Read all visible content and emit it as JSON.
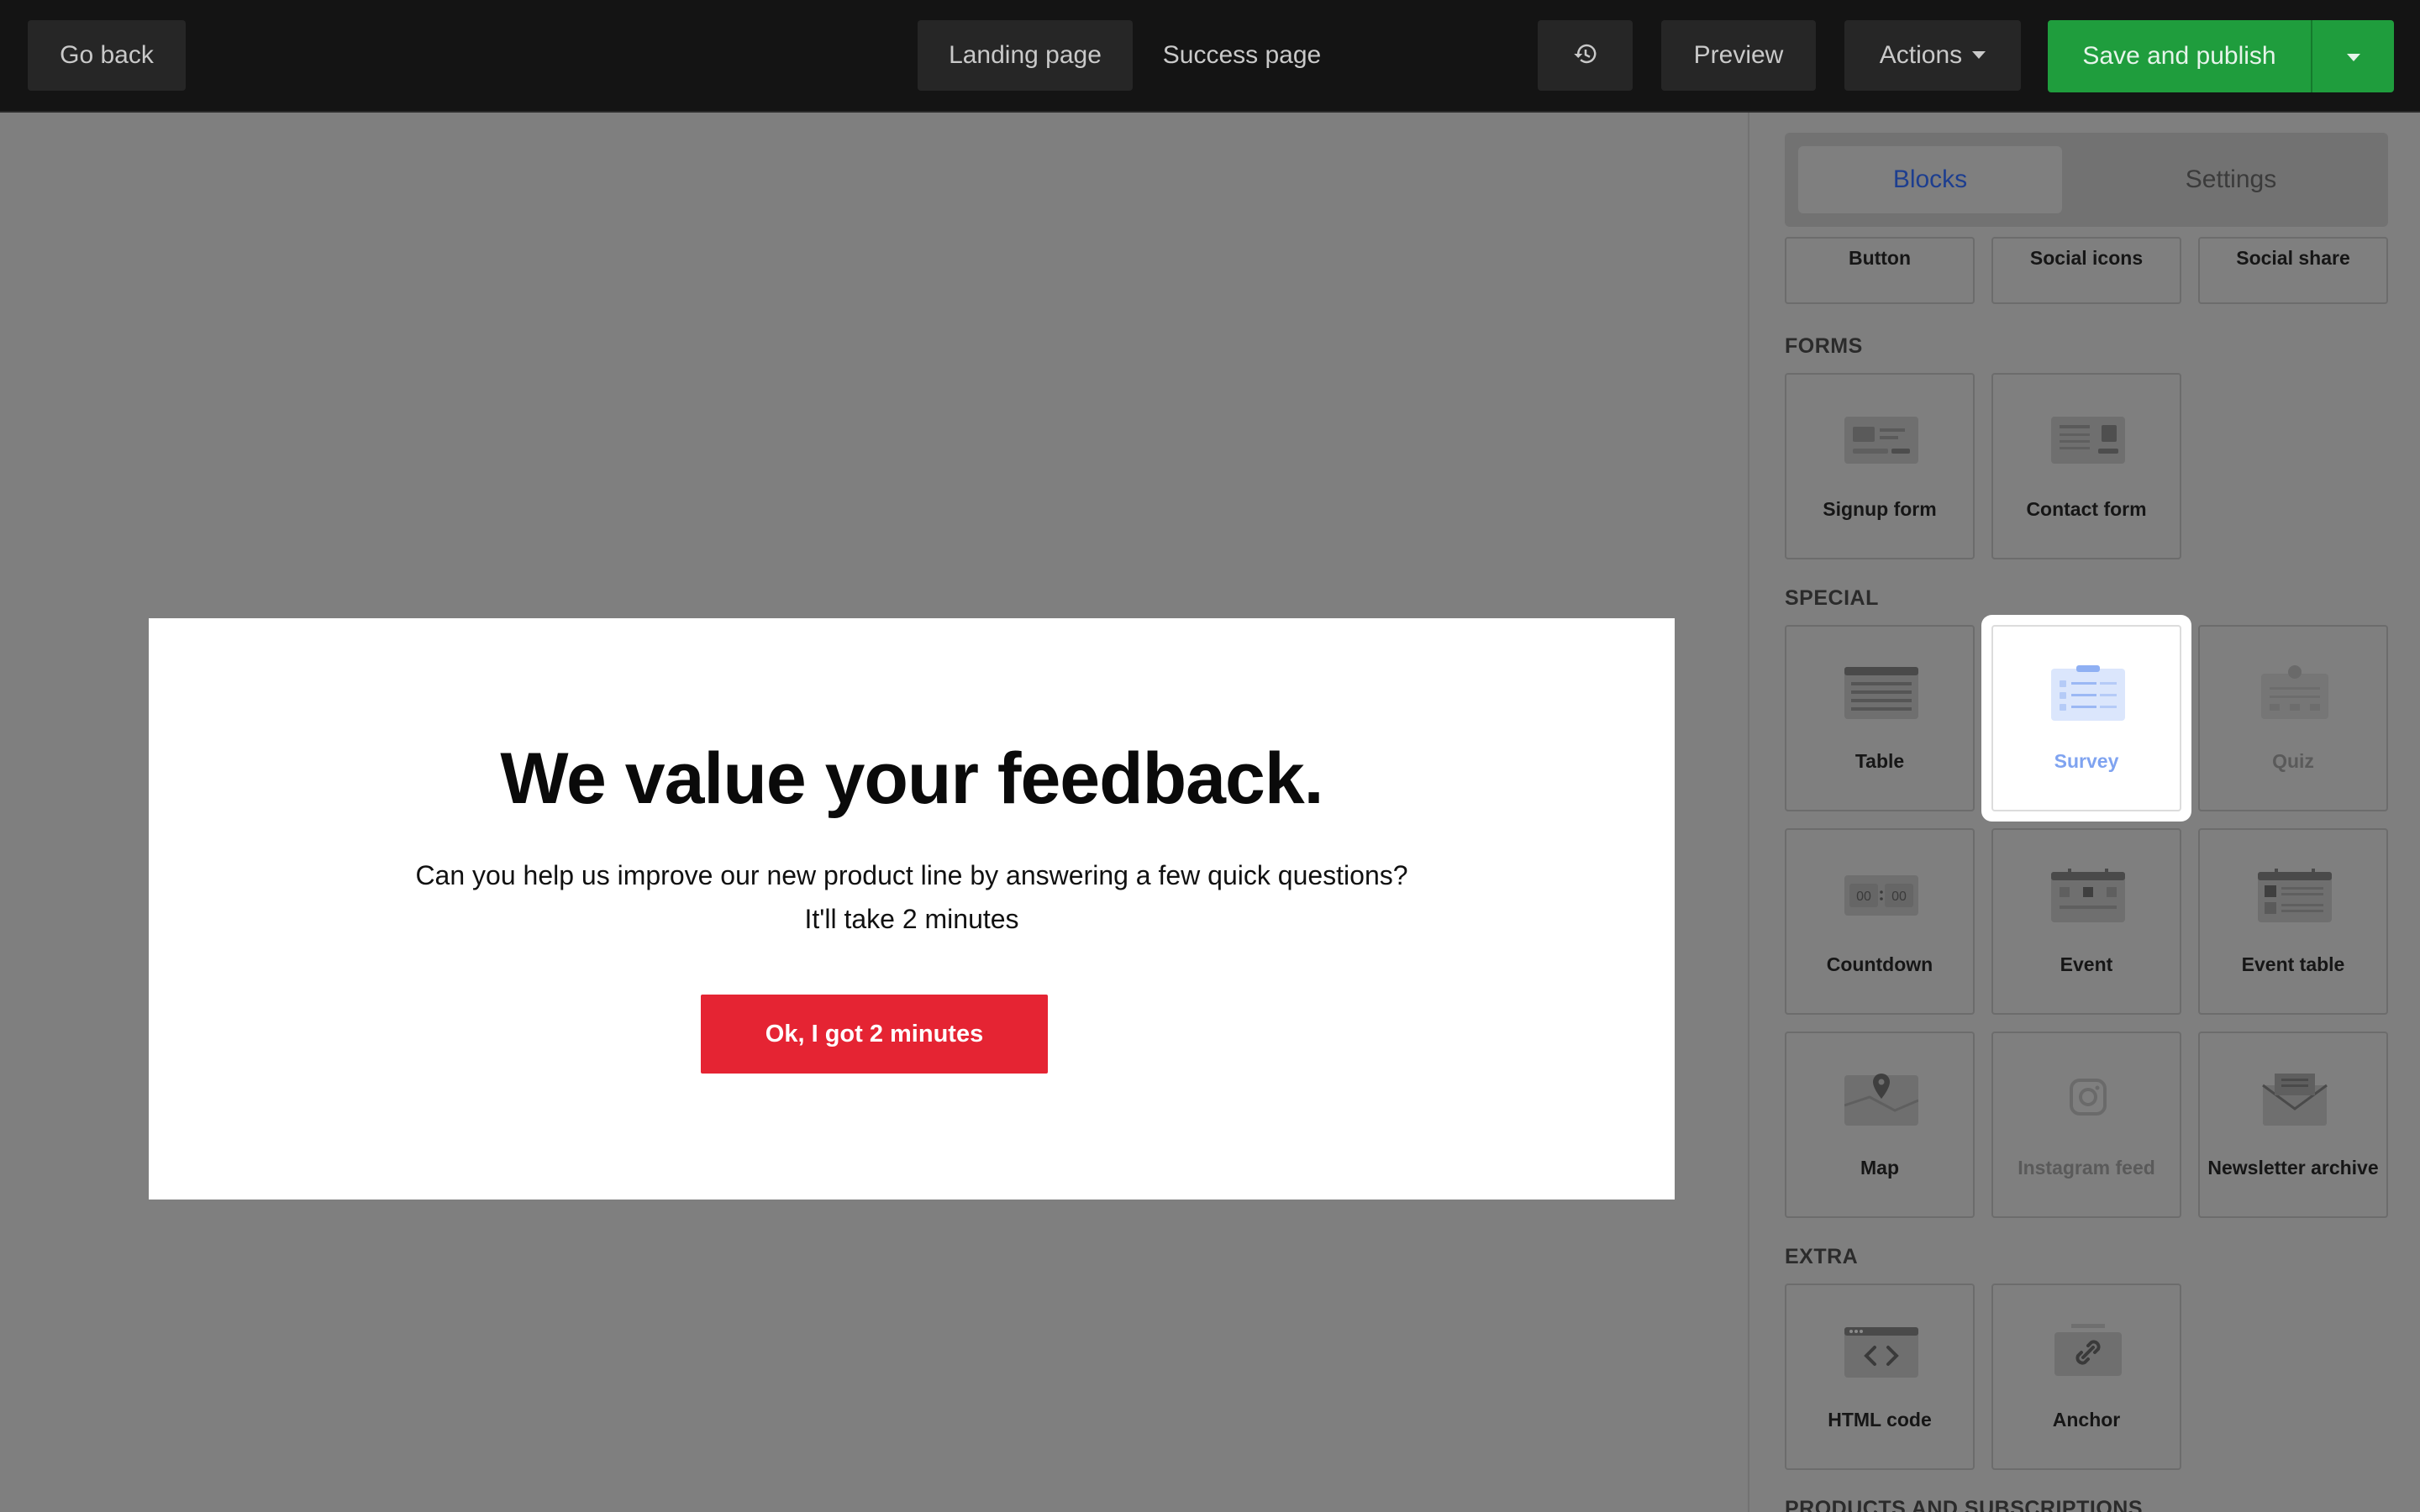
{
  "topbar": {
    "go_back": "Go back",
    "tabs": [
      "Landing page",
      "Success page"
    ],
    "history_icon": "history-icon",
    "preview": "Preview",
    "actions": "Actions",
    "save_publish": "Save and publish"
  },
  "modal": {
    "heading": "We value your feedback.",
    "line1": "Can you help us improve our new product line by answering a few quick questions?",
    "line2": "It'll take 2 minutes",
    "cta": "Ok, I got 2 minutes",
    "cta_color": "#e52433"
  },
  "sidebar": {
    "tabs": {
      "blocks": "Blocks",
      "settings": "Settings"
    },
    "top_row": [
      "Button",
      "Social icons",
      "Social share"
    ],
    "forms": {
      "title": "FORMS",
      "items": [
        "Signup form",
        "Contact form"
      ]
    },
    "special": {
      "title": "SPECIAL",
      "items": [
        "Table",
        "Survey",
        "Quiz",
        "Countdown",
        "Event",
        "Event table",
        "Map",
        "Instagram feed",
        "Newsletter archive"
      ]
    },
    "extra": {
      "title": "EXTRA",
      "items": [
        "HTML code",
        "Anchor"
      ]
    },
    "next_section": "PRODUCTS AND SUBSCRIPTIONS"
  }
}
